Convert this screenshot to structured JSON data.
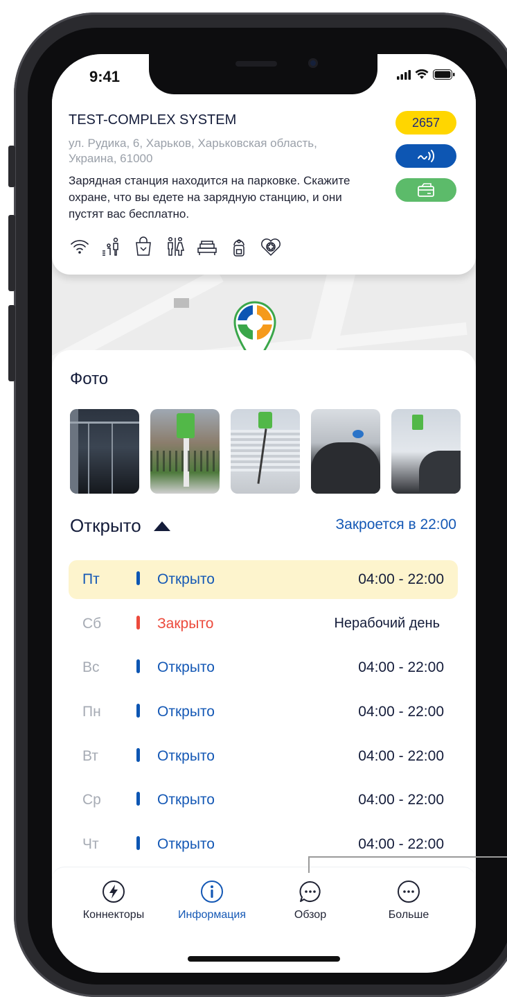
{
  "status_bar": {
    "time": "9:41"
  },
  "station": {
    "title": "TEST-COMPLEX SYSTEM",
    "address": "ул. Рудика, 6, Харьков, Харьковская область, Украина, 61000",
    "note": "Зарядная станция находится на парковке. Скажите охране, что вы едете на зарядную станцию, и они пустят вас бесплатно.",
    "id_badge": "2657",
    "amenities": [
      "wifi-icon",
      "family-icon",
      "shop-icon",
      "restroom-icon",
      "hotel-icon",
      "parking-tag-icon",
      "medical-icon"
    ]
  },
  "photos": {
    "title": "Фото",
    "count": 5
  },
  "hours": {
    "state": "Открыто",
    "closes_at": "Закроется в 22:00",
    "rows": [
      {
        "day": "Пт",
        "status": "Открыто",
        "hours": "04:00 - 22:00",
        "today": true
      },
      {
        "day": "Сб",
        "status": "Закрыто",
        "hours": "Нерабочий день"
      },
      {
        "day": "Вс",
        "status": "Открыто",
        "hours": "04:00 - 22:00"
      },
      {
        "day": "Пн",
        "status": "Открыто",
        "hours": "04:00 - 22:00"
      },
      {
        "day": "Вт",
        "status": "Открыто",
        "hours": "04:00 - 22:00"
      },
      {
        "day": "Ср",
        "status": "Открыто",
        "hours": "04:00 - 22:00"
      },
      {
        "day": "Чт",
        "status": "Открыто",
        "hours": "04:00 - 22:00"
      }
    ]
  },
  "tabs": [
    {
      "label": "Коннекторы",
      "icon": "lightning-icon"
    },
    {
      "label": "Информация",
      "icon": "info-icon",
      "active": true
    },
    {
      "label": "Обзор",
      "icon": "chat-icon"
    },
    {
      "label": "Больше",
      "icon": "more-icon"
    }
  ],
  "colors": {
    "accent": "#1458b5",
    "closed": "#ec4a3c",
    "badge_yellow": "#ffd600",
    "badge_blue": "#0d56b3",
    "badge_green": "#5cbb6a",
    "today_bg": "#fdf4cd"
  }
}
